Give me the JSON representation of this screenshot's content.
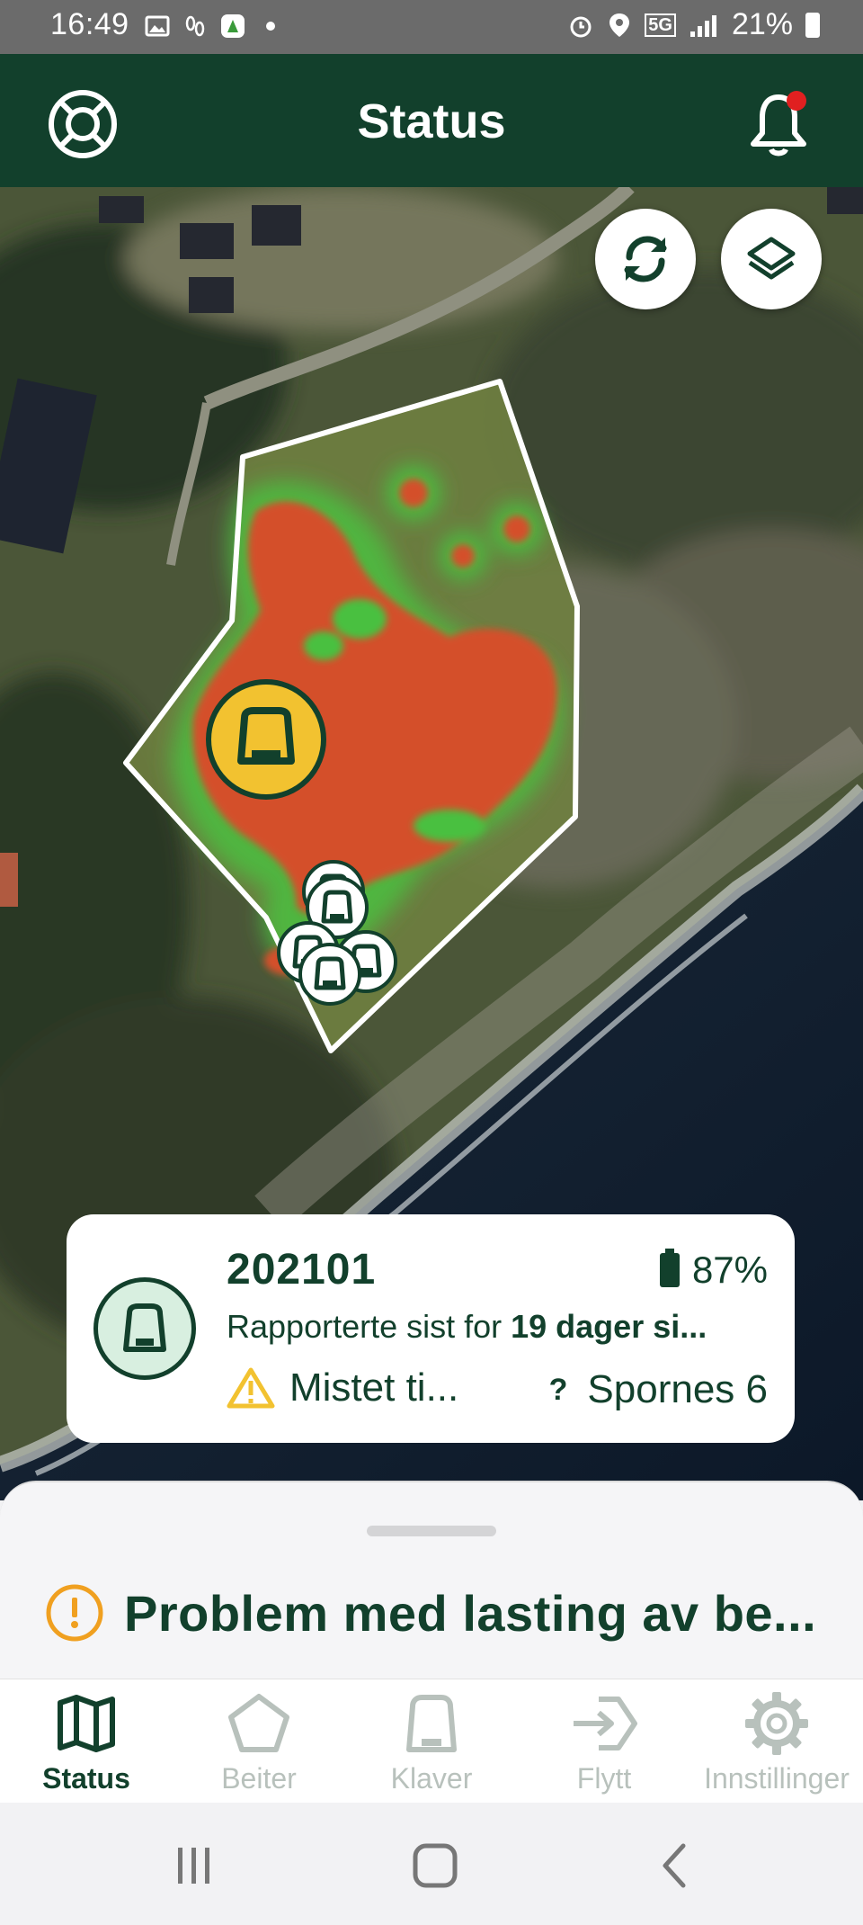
{
  "statusbar": {
    "time": "16:49",
    "network": "5G",
    "battery_percent": "21%",
    "icons": [
      "gallery-icon",
      "footsteps-icon",
      "app-icon",
      "dot-icon",
      "alarm-icon",
      "location-icon",
      "signal-icon",
      "battery-icon"
    ]
  },
  "header": {
    "title": "Status",
    "left_icon": "lifebuoy-icon",
    "right_icon": "bell-icon",
    "notification_dot_color": "#e02020"
  },
  "map": {
    "buttons": [
      {
        "name": "refresh-button",
        "icon": "refresh-icon"
      },
      {
        "name": "layers-button",
        "icon": "layers-icon"
      }
    ],
    "heatmap_color": "#d4502a",
    "selected_marker_color": "#f2c230"
  },
  "card": {
    "id": "202101",
    "battery": "87%",
    "reported_prefix": "Rapporterte sist for ",
    "reported_bold": "19 dager si...",
    "warning": "Mistet ti...",
    "tracks_icon": "?",
    "tracks": "Spornes 6"
  },
  "sheet": {
    "problem": "Problem med lasting av be..."
  },
  "nav": {
    "items": [
      {
        "label": "Status",
        "icon": "map-icon",
        "active": true
      },
      {
        "label": "Beiter",
        "icon": "pentagon-icon",
        "active": false
      },
      {
        "label": "Klaver",
        "icon": "collar-icon",
        "active": false
      },
      {
        "label": "Flytt",
        "icon": "move-icon",
        "active": false
      },
      {
        "label": "Innstillinger",
        "icon": "gear-icon",
        "active": false
      }
    ]
  },
  "colors": {
    "brand": "#12402c",
    "inactive": "#b8c1bc",
    "warning": "#f2c230",
    "problem": "#f0a020"
  }
}
